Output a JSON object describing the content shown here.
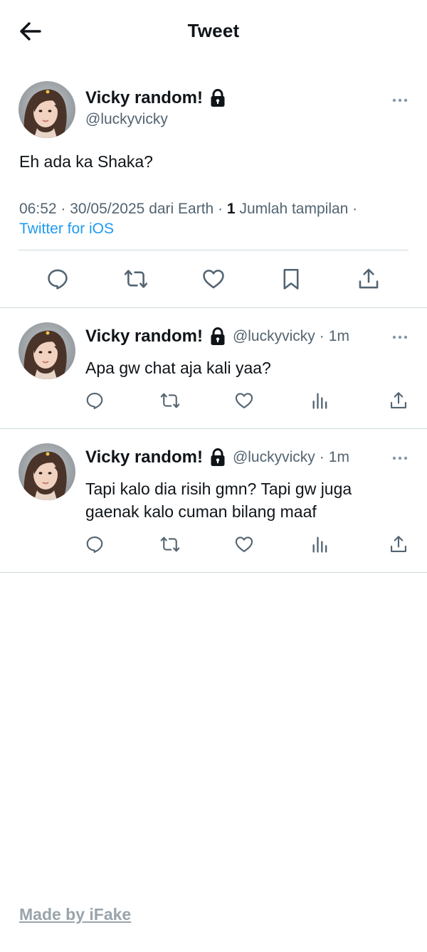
{
  "header": {
    "title": "Tweet",
    "back_icon": "arrow-left-icon"
  },
  "main_tweet": {
    "display_name": "Vicky random!",
    "handle": "@luckyvicky",
    "text": "Eh ada ka Shaka?",
    "time": "06:52",
    "date": "30/05/2025",
    "location": "dari Earth",
    "views_count": "1",
    "views_label": "Jumlah tampilan",
    "source": "Twitter for iOS",
    "actions": [
      "reply-icon",
      "retweet-icon",
      "like-icon",
      "bookmark-icon",
      "share-icon"
    ]
  },
  "replies": [
    {
      "display_name": "Vicky random!",
      "handle": "@luckyvicky",
      "dot": "·",
      "time": "1m",
      "text": "Apa gw chat aja kali yaa?"
    },
    {
      "display_name": "Vicky random!",
      "handle": "@luckyvicky",
      "dot": "·",
      "time": "1m",
      "text": "Tapi kalo dia risih gmn? Tapi gw juga gaenak kalo cuman bilang maaf"
    }
  ],
  "footer": {
    "credit": "Made by iFake"
  },
  "colors": {
    "text": "#0f1419",
    "secondary": "#536471",
    "link": "#1d9bf0",
    "divider": "#cfd9de",
    "footer": "#9aa4ab"
  }
}
